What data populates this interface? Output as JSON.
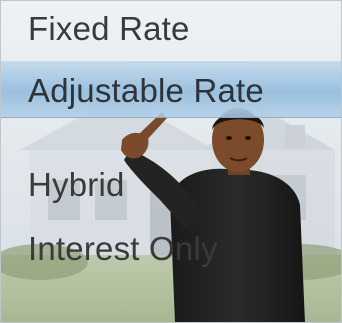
{
  "menu": {
    "items": [
      {
        "label": "Fixed Rate"
      },
      {
        "label": "Adjustable Rate",
        "highlighted": true
      },
      {
        "label": "Hybrid"
      },
      {
        "label": "Interest Only"
      }
    ]
  },
  "colors": {
    "highlight_band": "#9cc0de",
    "text": "#3a3a3a",
    "background": "#e2e8ed"
  }
}
